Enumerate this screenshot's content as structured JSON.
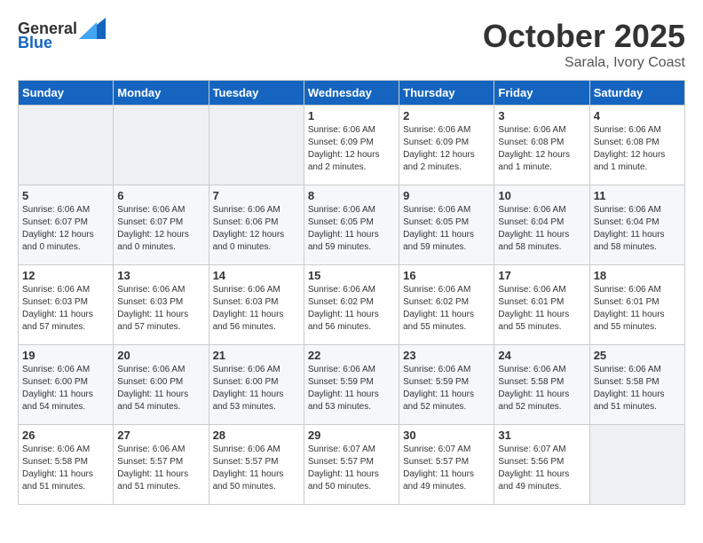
{
  "logo": {
    "general": "General",
    "blue": "Blue"
  },
  "title": "October 2025",
  "subtitle": "Sarala, Ivory Coast",
  "days_of_week": [
    "Sunday",
    "Monday",
    "Tuesday",
    "Wednesday",
    "Thursday",
    "Friday",
    "Saturday"
  ],
  "weeks": [
    [
      {
        "day": "",
        "info": ""
      },
      {
        "day": "",
        "info": ""
      },
      {
        "day": "",
        "info": ""
      },
      {
        "day": "1",
        "info": "Sunrise: 6:06 AM\nSunset: 6:09 PM\nDaylight: 12 hours and 2 minutes."
      },
      {
        "day": "2",
        "info": "Sunrise: 6:06 AM\nSunset: 6:09 PM\nDaylight: 12 hours and 2 minutes."
      },
      {
        "day": "3",
        "info": "Sunrise: 6:06 AM\nSunset: 6:08 PM\nDaylight: 12 hours and 1 minute."
      },
      {
        "day": "4",
        "info": "Sunrise: 6:06 AM\nSunset: 6:08 PM\nDaylight: 12 hours and 1 minute."
      }
    ],
    [
      {
        "day": "5",
        "info": "Sunrise: 6:06 AM\nSunset: 6:07 PM\nDaylight: 12 hours and 0 minutes."
      },
      {
        "day": "6",
        "info": "Sunrise: 6:06 AM\nSunset: 6:07 PM\nDaylight: 12 hours and 0 minutes."
      },
      {
        "day": "7",
        "info": "Sunrise: 6:06 AM\nSunset: 6:06 PM\nDaylight: 12 hours and 0 minutes."
      },
      {
        "day": "8",
        "info": "Sunrise: 6:06 AM\nSunset: 6:05 PM\nDaylight: 11 hours and 59 minutes."
      },
      {
        "day": "9",
        "info": "Sunrise: 6:06 AM\nSunset: 6:05 PM\nDaylight: 11 hours and 59 minutes."
      },
      {
        "day": "10",
        "info": "Sunrise: 6:06 AM\nSunset: 6:04 PM\nDaylight: 11 hours and 58 minutes."
      },
      {
        "day": "11",
        "info": "Sunrise: 6:06 AM\nSunset: 6:04 PM\nDaylight: 11 hours and 58 minutes."
      }
    ],
    [
      {
        "day": "12",
        "info": "Sunrise: 6:06 AM\nSunset: 6:03 PM\nDaylight: 11 hours and 57 minutes."
      },
      {
        "day": "13",
        "info": "Sunrise: 6:06 AM\nSunset: 6:03 PM\nDaylight: 11 hours and 57 minutes."
      },
      {
        "day": "14",
        "info": "Sunrise: 6:06 AM\nSunset: 6:03 PM\nDaylight: 11 hours and 56 minutes."
      },
      {
        "day": "15",
        "info": "Sunrise: 6:06 AM\nSunset: 6:02 PM\nDaylight: 11 hours and 56 minutes."
      },
      {
        "day": "16",
        "info": "Sunrise: 6:06 AM\nSunset: 6:02 PM\nDaylight: 11 hours and 55 minutes."
      },
      {
        "day": "17",
        "info": "Sunrise: 6:06 AM\nSunset: 6:01 PM\nDaylight: 11 hours and 55 minutes."
      },
      {
        "day": "18",
        "info": "Sunrise: 6:06 AM\nSunset: 6:01 PM\nDaylight: 11 hours and 55 minutes."
      }
    ],
    [
      {
        "day": "19",
        "info": "Sunrise: 6:06 AM\nSunset: 6:00 PM\nDaylight: 11 hours and 54 minutes."
      },
      {
        "day": "20",
        "info": "Sunrise: 6:06 AM\nSunset: 6:00 PM\nDaylight: 11 hours and 54 minutes."
      },
      {
        "day": "21",
        "info": "Sunrise: 6:06 AM\nSunset: 6:00 PM\nDaylight: 11 hours and 53 minutes."
      },
      {
        "day": "22",
        "info": "Sunrise: 6:06 AM\nSunset: 5:59 PM\nDaylight: 11 hours and 53 minutes."
      },
      {
        "day": "23",
        "info": "Sunrise: 6:06 AM\nSunset: 5:59 PM\nDaylight: 11 hours and 52 minutes."
      },
      {
        "day": "24",
        "info": "Sunrise: 6:06 AM\nSunset: 5:58 PM\nDaylight: 11 hours and 52 minutes."
      },
      {
        "day": "25",
        "info": "Sunrise: 6:06 AM\nSunset: 5:58 PM\nDaylight: 11 hours and 51 minutes."
      }
    ],
    [
      {
        "day": "26",
        "info": "Sunrise: 6:06 AM\nSunset: 5:58 PM\nDaylight: 11 hours and 51 minutes."
      },
      {
        "day": "27",
        "info": "Sunrise: 6:06 AM\nSunset: 5:57 PM\nDaylight: 11 hours and 51 minutes."
      },
      {
        "day": "28",
        "info": "Sunrise: 6:06 AM\nSunset: 5:57 PM\nDaylight: 11 hours and 50 minutes."
      },
      {
        "day": "29",
        "info": "Sunrise: 6:07 AM\nSunset: 5:57 PM\nDaylight: 11 hours and 50 minutes."
      },
      {
        "day": "30",
        "info": "Sunrise: 6:07 AM\nSunset: 5:57 PM\nDaylight: 11 hours and 49 minutes."
      },
      {
        "day": "31",
        "info": "Sunrise: 6:07 AM\nSunset: 5:56 PM\nDaylight: 11 hours and 49 minutes."
      },
      {
        "day": "",
        "info": ""
      }
    ]
  ]
}
